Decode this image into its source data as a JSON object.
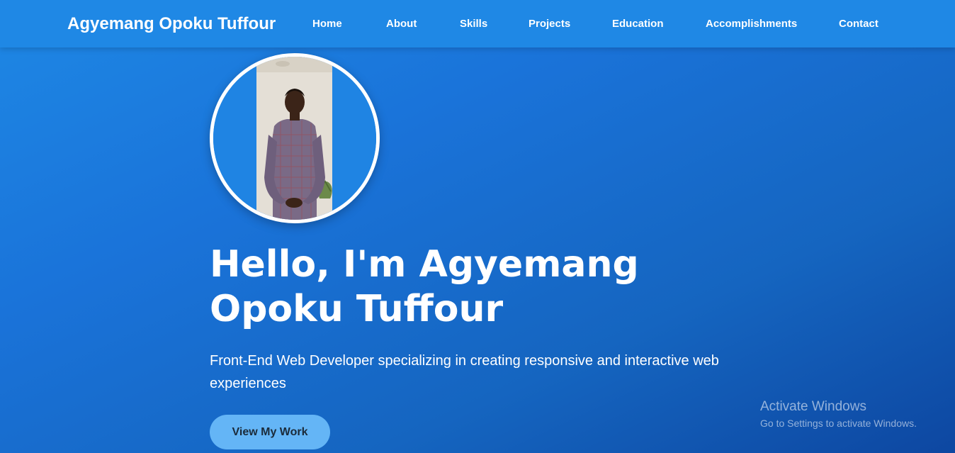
{
  "nav": {
    "brand": "Agyemang Opoku Tuffour",
    "links": [
      "Home",
      "About",
      "Skills",
      "Projects",
      "Education",
      "Accomplishments",
      "Contact"
    ]
  },
  "hero": {
    "profile_image_icon": "profile-photo",
    "title": "Hello, I'm Agyemang Opoku Tuffour",
    "subtitle": "Front-End Web Developer specializing in creating responsive and interactive web experiences",
    "cta_label": "View My Work"
  },
  "watermark": {
    "title": "Activate Windows",
    "subtitle": "Go to Settings to activate Windows."
  },
  "colors": {
    "navbar": "#1f88e5",
    "background_start": "#1e88e5",
    "background_end": "#0d47a1",
    "cta_background": "#64b5f6",
    "cta_text": "#1b2b3a"
  }
}
